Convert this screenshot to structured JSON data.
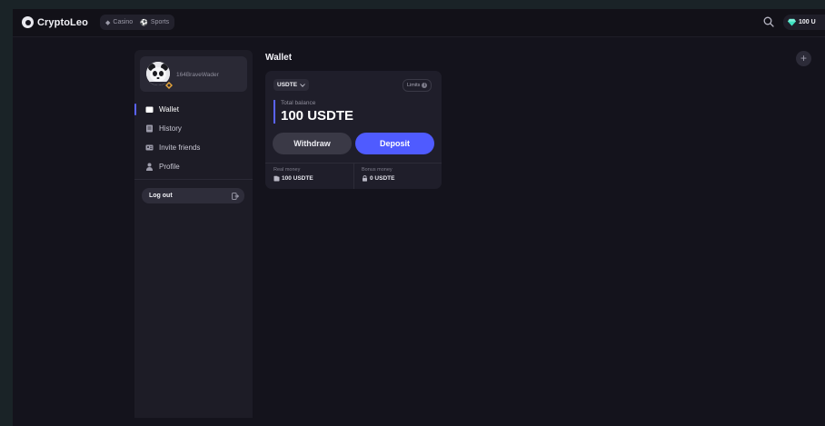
{
  "header": {
    "brand": "CryptoLeo",
    "tabs": [
      {
        "label": "Casino",
        "icon": "casino-icon"
      },
      {
        "label": "Sports",
        "icon": "sports-ball-icon"
      }
    ],
    "balance": "100 U"
  },
  "sidebar": {
    "username": "164BraveWader",
    "items": [
      {
        "label": "Wallet",
        "icon": "wallet-icon",
        "active": true
      },
      {
        "label": "History",
        "icon": "history-icon",
        "active": false
      },
      {
        "label": "Invite friends",
        "icon": "invite-icon",
        "active": false
      },
      {
        "label": "Profile",
        "icon": "profile-icon",
        "active": false
      }
    ],
    "logout_label": "Log out"
  },
  "main": {
    "title": "Wallet",
    "card": {
      "currency": "USDTE",
      "limits_label": "Limits",
      "total_label": "Total balance",
      "total_value": "100 USDTE",
      "withdraw_label": "Withdraw",
      "deposit_label": "Deposit",
      "real_money_label": "Real money",
      "real_money_value": "100 USDTE",
      "bonus_money_label": "Bonus money",
      "bonus_money_value": "0 USDTE"
    }
  },
  "colors": {
    "accent": "#4f5bff",
    "background": "#14131c",
    "panel": "#1d1c26"
  }
}
